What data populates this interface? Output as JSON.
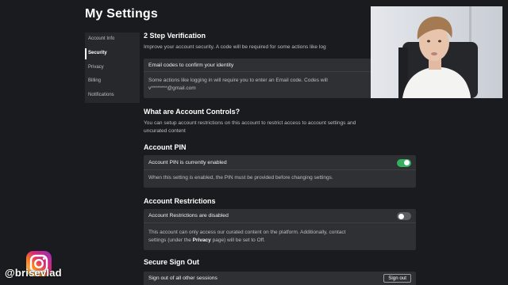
{
  "page": {
    "title": "My Settings"
  },
  "sidebar": {
    "items": [
      {
        "label": "Account Info",
        "active": false
      },
      {
        "label": "Security",
        "active": true
      },
      {
        "label": "Privacy",
        "active": false
      },
      {
        "label": "Billing",
        "active": false
      },
      {
        "label": "Notifications",
        "active": false
      }
    ]
  },
  "two_step": {
    "title": "2 Step Verification",
    "description": "Improve your account security. A code will be required for some actions like log",
    "email_option": {
      "label": "Email codes to confirm your identity",
      "line1": "Some actions like logging in will require you to enter an Email code. Codes will",
      "line2": "v********@gmail.com"
    }
  },
  "account_controls": {
    "title": "What are Account Controls?",
    "line1": "You can setup account restrictions on this account to restrict access to account settings and",
    "line2": "uncurated content"
  },
  "account_pin": {
    "title": "Account PIN",
    "status": "Account PIN is currently enabled",
    "enabled": true,
    "description": "When this setting is enabled, the PIN must be provided before changing settings."
  },
  "account_restrictions": {
    "title": "Account Restrictions",
    "status": "Account Restrictions are disabled",
    "enabled": false,
    "line1": "This account can only access our curated content on the platform. Additionally, contact",
    "line2_pre": "settings (under the ",
    "line2_bold": "Privacy",
    "line2_post": " page) will be set to Off."
  },
  "secure_sign_out": {
    "title": "Secure Sign Out",
    "row_label": "Sign out of all other sessions",
    "button_label": "Sign out"
  },
  "overlay": {
    "handle": "@brisevlad"
  },
  "colors": {
    "background": "#1a1b1e",
    "panel": "#2e3034",
    "toggle_on": "#34b15e",
    "toggle_off": "#5b5e63"
  }
}
